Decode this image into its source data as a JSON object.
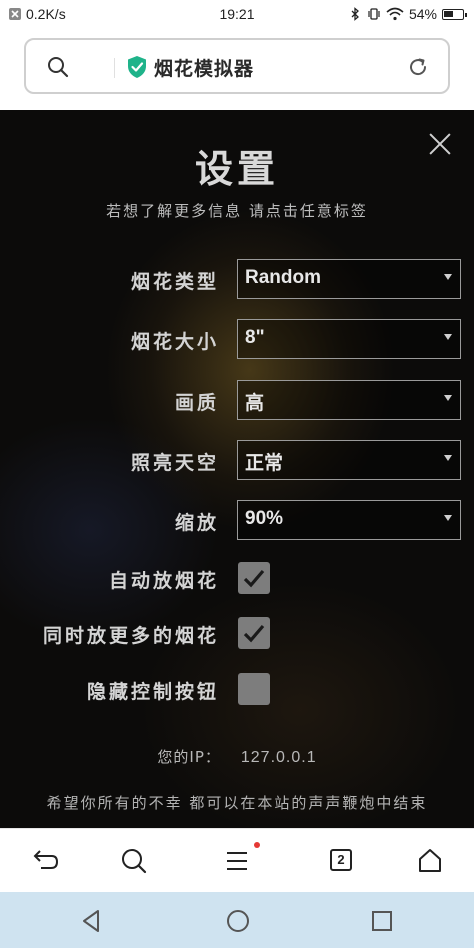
{
  "status_bar": {
    "net_speed": "0.2K/s",
    "time": "19:21",
    "battery": "54%",
    "battery_level": 0.54
  },
  "address_bar": {
    "title": "烟花模拟器",
    "search_icon": "search-icon",
    "secure_icon": "shield-check-icon",
    "reload_icon": "reload-icon"
  },
  "menu": {
    "title": "设置",
    "subtitle": "若想了解更多信息 请点击任意标签",
    "settings": [
      {
        "label": "烟花类型",
        "type": "select",
        "value": "Random"
      },
      {
        "label": "烟花大小",
        "type": "select",
        "value": "8\""
      },
      {
        "label": "画质",
        "type": "select",
        "value": "高"
      },
      {
        "label": "照亮天空",
        "type": "select",
        "value": "正常"
      },
      {
        "label": "缩放",
        "type": "select",
        "value": "90%"
      },
      {
        "label": "自动放烟花",
        "type": "checkbox",
        "checked": true
      },
      {
        "label": "同时放更多的烟花",
        "type": "checkbox",
        "checked": true
      },
      {
        "label": "隐藏控制按钮",
        "type": "checkbox",
        "checked": false
      }
    ],
    "ip_label": "您的IP：",
    "ip_value": "127.0.0.1",
    "footer": "希望你所有的不幸 都可以在本站的声声鞭炮中结束"
  },
  "toolbar": {
    "tab_count": "2",
    "icons": [
      "back-icon",
      "search-icon",
      "menu-icon",
      "tabs-icon",
      "home-icon"
    ]
  },
  "nav_bar": {
    "icons": [
      "nav-back-icon",
      "nav-home-icon",
      "nav-recent-icon"
    ]
  }
}
